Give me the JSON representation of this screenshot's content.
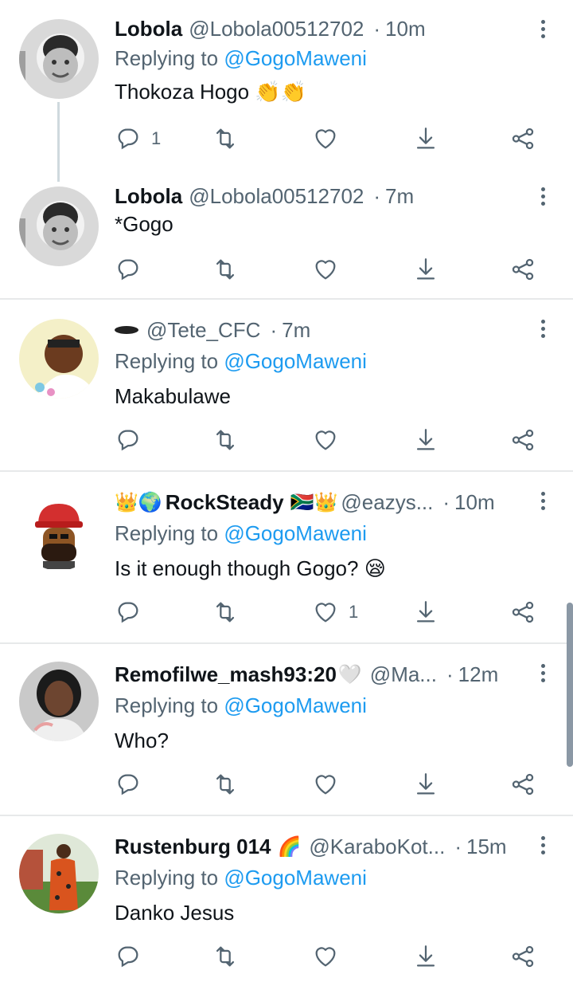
{
  "tweets": [
    {
      "name": "Lobola",
      "handle": "@Lobola00512702",
      "time": "10m",
      "replying_prefix": "Replying to ",
      "replying_to": "@GogoMaweni",
      "text": "Thokoza Hogo 👏👏",
      "reply_count": "1",
      "like_count": "",
      "emoji_prefix": "",
      "emoji_suffix": ""
    },
    {
      "name": "Lobola",
      "handle": "@Lobola00512702",
      "time": "7m",
      "text": "*Gogo",
      "reply_count": "",
      "like_count": ""
    },
    {
      "name": "",
      "handle": "@Tete_CFC",
      "time": "7m",
      "replying_prefix": "Replying to ",
      "replying_to": "@GogoMaweni",
      "text": "Makabulawe",
      "reply_count": "",
      "like_count": ""
    },
    {
      "name": "RockSteady",
      "name_prefix": "👑🌍",
      "name_suffix": "🇿🇦👑",
      "handle": "@eazys...",
      "time": "10m",
      "replying_prefix": "Replying to ",
      "replying_to": "@GogoMaweni",
      "text": "Is it enough though Gogo? 😪",
      "reply_count": "",
      "like_count": "1"
    },
    {
      "name": "Remofilwe_mash93:20",
      "name_suffix": "🤍",
      "handle": "@Ma...",
      "time": "12m",
      "replying_prefix": "Replying to ",
      "replying_to": "@GogoMaweni",
      "text": "Who?",
      "reply_count": "",
      "like_count": ""
    },
    {
      "name": "Rustenburg 014",
      "name_suffix": "🌈",
      "handle": "@KaraboKot...",
      "time": "15m",
      "replying_prefix": "Replying to ",
      "replying_to": "@GogoMaweni",
      "text": "Danko Jesus",
      "reply_count": "",
      "like_count": ""
    }
  ],
  "separator": "·",
  "icons": [
    "reply-icon",
    "retweet-icon",
    "like-icon",
    "share-down-icon",
    "share-network-icon",
    "more-options-icon"
  ],
  "colors": {
    "link": "#1d9bf0",
    "secondary_text": "#536471",
    "divider": "#e7e9ea"
  }
}
